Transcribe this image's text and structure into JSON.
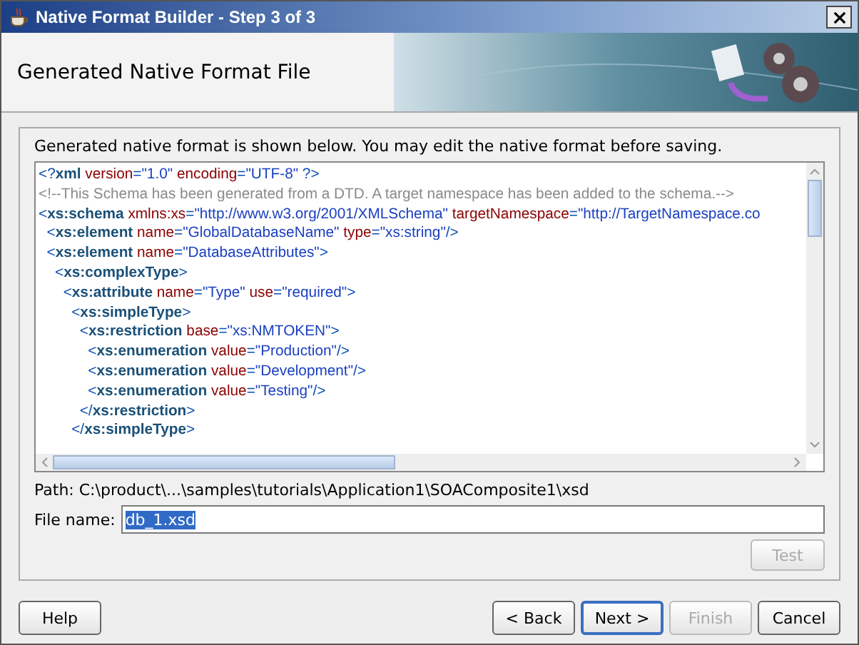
{
  "window": {
    "title": "Native Format Builder - Step 3 of 3"
  },
  "header": {
    "title": "Generated Native Format File"
  },
  "instructions": "Generated native format is shown below. You may edit the native format before saving.",
  "code_lines": [
    [
      {
        "kind": "punct",
        "text": "<?"
      },
      {
        "kind": "tag",
        "text": "xml"
      },
      {
        "kind": "attr",
        "text": " version"
      },
      {
        "kind": "punct",
        "text": "="
      },
      {
        "kind": "value",
        "text": "\"1.0\""
      },
      {
        "kind": "attr",
        "text": " encoding"
      },
      {
        "kind": "punct",
        "text": "="
      },
      {
        "kind": "value",
        "text": "\"UTF-8\""
      },
      {
        "kind": "punct",
        "text": " ?>"
      }
    ],
    [
      {
        "kind": "comment",
        "text": "<!--This Schema has been generated from a DTD. A target namespace has been added to the schema.-->"
      }
    ],
    [
      {
        "kind": "punct",
        "text": "<"
      },
      {
        "kind": "tag",
        "text": "xs:schema"
      },
      {
        "kind": "attr",
        "text": " xmlns:xs"
      },
      {
        "kind": "punct",
        "text": "="
      },
      {
        "kind": "value",
        "text": "\"http://www.w3.org/2001/XMLSchema\""
      },
      {
        "kind": "attr",
        "text": " targetNamespace"
      },
      {
        "kind": "punct",
        "text": "="
      },
      {
        "kind": "value",
        "text": "\"http://TargetNamespace.co"
      }
    ],
    [
      {
        "kind": "punct",
        "text": "  <"
      },
      {
        "kind": "tag",
        "text": "xs:element"
      },
      {
        "kind": "attr",
        "text": " name"
      },
      {
        "kind": "punct",
        "text": "="
      },
      {
        "kind": "value",
        "text": "\"GlobalDatabaseName\""
      },
      {
        "kind": "attr",
        "text": " type"
      },
      {
        "kind": "punct",
        "text": "="
      },
      {
        "kind": "value",
        "text": "\"xs:string\""
      },
      {
        "kind": "punct",
        "text": "/>"
      }
    ],
    [
      {
        "kind": "punct",
        "text": "  <"
      },
      {
        "kind": "tag",
        "text": "xs:element"
      },
      {
        "kind": "attr",
        "text": " name"
      },
      {
        "kind": "punct",
        "text": "="
      },
      {
        "kind": "value",
        "text": "\"DatabaseAttributes\""
      },
      {
        "kind": "punct",
        "text": ">"
      }
    ],
    [
      {
        "kind": "punct",
        "text": "    <"
      },
      {
        "kind": "tag",
        "text": "xs:complexType"
      },
      {
        "kind": "punct",
        "text": ">"
      }
    ],
    [
      {
        "kind": "punct",
        "text": "      <"
      },
      {
        "kind": "tag",
        "text": "xs:attribute"
      },
      {
        "kind": "attr",
        "text": " name"
      },
      {
        "kind": "punct",
        "text": "="
      },
      {
        "kind": "value",
        "text": "\"Type\""
      },
      {
        "kind": "attr",
        "text": " use"
      },
      {
        "kind": "punct",
        "text": "="
      },
      {
        "kind": "value",
        "text": "\"required\""
      },
      {
        "kind": "punct",
        "text": ">"
      }
    ],
    [
      {
        "kind": "punct",
        "text": "        <"
      },
      {
        "kind": "tag",
        "text": "xs:simpleType"
      },
      {
        "kind": "punct",
        "text": ">"
      }
    ],
    [
      {
        "kind": "punct",
        "text": "          <"
      },
      {
        "kind": "tag",
        "text": "xs:restriction"
      },
      {
        "kind": "attr",
        "text": " base"
      },
      {
        "kind": "punct",
        "text": "="
      },
      {
        "kind": "value",
        "text": "\"xs:NMTOKEN\""
      },
      {
        "kind": "punct",
        "text": ">"
      }
    ],
    [
      {
        "kind": "punct",
        "text": "            <"
      },
      {
        "kind": "tag",
        "text": "xs:enumeration"
      },
      {
        "kind": "attr",
        "text": " value"
      },
      {
        "kind": "punct",
        "text": "="
      },
      {
        "kind": "value",
        "text": "\"Production\""
      },
      {
        "kind": "punct",
        "text": "/>"
      }
    ],
    [
      {
        "kind": "punct",
        "text": "            <"
      },
      {
        "kind": "tag",
        "text": "xs:enumeration"
      },
      {
        "kind": "attr",
        "text": " value"
      },
      {
        "kind": "punct",
        "text": "="
      },
      {
        "kind": "value",
        "text": "\"Development\""
      },
      {
        "kind": "punct",
        "text": "/>"
      }
    ],
    [
      {
        "kind": "punct",
        "text": "            <"
      },
      {
        "kind": "tag",
        "text": "xs:enumeration"
      },
      {
        "kind": "attr",
        "text": " value"
      },
      {
        "kind": "punct",
        "text": "="
      },
      {
        "kind": "value",
        "text": "\"Testing\""
      },
      {
        "kind": "punct",
        "text": "/>"
      }
    ],
    [
      {
        "kind": "punct",
        "text": "          </"
      },
      {
        "kind": "tag",
        "text": "xs:restriction"
      },
      {
        "kind": "punct",
        "text": ">"
      }
    ],
    [
      {
        "kind": "punct",
        "text": "        </"
      },
      {
        "kind": "tag",
        "text": "xs:simpleType"
      },
      {
        "kind": "punct",
        "text": ">"
      }
    ]
  ],
  "path": "Path: C:\\product\\...\\samples\\tutorials\\Application1\\SOAComposite1\\xsd",
  "file_name": {
    "label": "File name:",
    "value": "db_1.xsd"
  },
  "test_button": {
    "label": "Test",
    "disabled": true
  },
  "buttons": [
    {
      "label": "Help",
      "disabled": false,
      "default": false
    },
    {
      "label": "< Back",
      "disabled": false,
      "default": false
    },
    {
      "label": "Next >",
      "disabled": false,
      "default": true
    },
    {
      "label": "Finish",
      "disabled": true,
      "default": false
    },
    {
      "label": "Cancel",
      "disabled": false,
      "default": false
    }
  ]
}
